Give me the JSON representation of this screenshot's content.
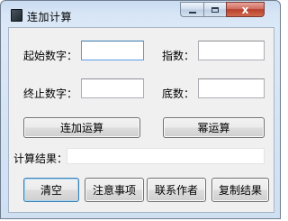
{
  "window": {
    "title": "连加计算",
    "close_glyph": "x"
  },
  "form": {
    "start_label": "起始数字：",
    "start_value": "",
    "exponent_label": "指数：",
    "exponent_value": "",
    "end_label": "终止数字：",
    "end_value": "",
    "base_label": "底数：",
    "base_value": "",
    "sum_button": "连加运算",
    "power_button": "幂运算",
    "result_label": "计算结果：",
    "result_value": ""
  },
  "actions": {
    "clear": "清空",
    "notes": "注意事项",
    "contact": "联系作者",
    "copy": "复制结果"
  }
}
